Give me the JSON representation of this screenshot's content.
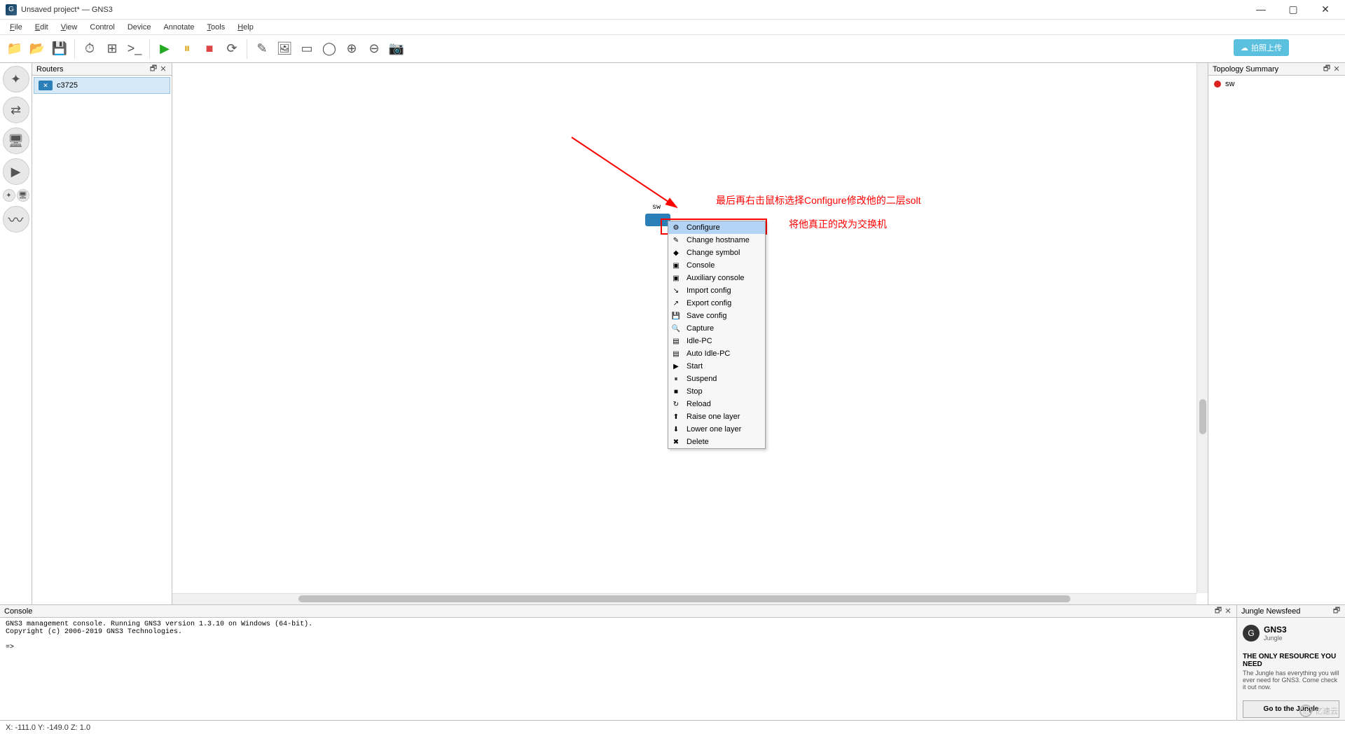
{
  "window": {
    "title": "Unsaved project* — GNS3"
  },
  "menu": [
    "File",
    "Edit",
    "View",
    "Control",
    "Device",
    "Annotate",
    "Tools",
    "Help"
  ],
  "upload_badge": "拍照上传",
  "routers_panel": {
    "title": "Routers",
    "items": [
      "c3725"
    ]
  },
  "device": {
    "label": "sw"
  },
  "context_menu": [
    {
      "icon": "⚙",
      "label": "Configure",
      "selected": true
    },
    {
      "icon": "✎",
      "label": "Change hostname"
    },
    {
      "icon": "◆",
      "label": "Change symbol"
    },
    {
      "icon": "▣",
      "label": "Console"
    },
    {
      "icon": "▣",
      "label": "Auxiliary console"
    },
    {
      "icon": "↘",
      "label": "Import config"
    },
    {
      "icon": "↗",
      "label": "Export config"
    },
    {
      "icon": "💾",
      "label": "Save config"
    },
    {
      "icon": "🔍",
      "label": "Capture"
    },
    {
      "icon": "▤",
      "label": "Idle-PC"
    },
    {
      "icon": "▤",
      "label": "Auto Idle-PC"
    },
    {
      "icon": "▶",
      "label": "Start"
    },
    {
      "icon": "⏸",
      "label": "Suspend"
    },
    {
      "icon": "■",
      "label": "Stop"
    },
    {
      "icon": "↻",
      "label": "Reload"
    },
    {
      "icon": "⬆",
      "label": "Raise one layer"
    },
    {
      "icon": "⬇",
      "label": "Lower one layer"
    },
    {
      "icon": "✖",
      "label": "Delete"
    }
  ],
  "annotations": {
    "line1": "最后再右击鼠标选择Configure修改他的二层solt",
    "line2": "将他真正的改为交换机"
  },
  "topology": {
    "title": "Topology Summary",
    "items": [
      {
        "name": "sw",
        "status": "stopped"
      }
    ]
  },
  "console": {
    "title": "Console",
    "text": "GNS3 management console. Running GNS3 version 1.3.10 on Windows (64-bit).\nCopyright (c) 2006-2019 GNS3 Technologies.\n\n=>"
  },
  "jungle": {
    "title": "Jungle Newsfeed",
    "brand": "GNS3",
    "brand_sub": "Jungle",
    "headline": "THE ONLY RESOURCE YOU NEED",
    "desc": "The Jungle has everything you will ever need for GNS3. Come check it out now.",
    "button": "Go to the Jungle"
  },
  "statusbar": "X: -111.0 Y: -149.0 Z: 1.0",
  "watermark": "亿速云"
}
